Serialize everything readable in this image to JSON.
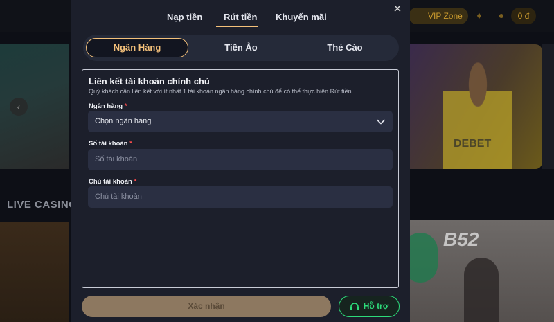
{
  "background": {
    "vip_label": "VIP Zone",
    "balance": "0 đ",
    "section_title": "LIVE CASINO",
    "hero_text": "DEBET",
    "card_text": "B52"
  },
  "modal": {
    "tabs": [
      {
        "label": "Nạp tiền",
        "active": false
      },
      {
        "label": "Rút tiền",
        "active": true
      },
      {
        "label": "Khuyến mãi",
        "active": false
      }
    ],
    "close_icon": "close-icon",
    "subtabs": [
      {
        "label": "Ngân Hàng",
        "active": true
      },
      {
        "label": "Tiền Ảo",
        "active": false
      },
      {
        "label": "Thẻ Cào",
        "active": false
      }
    ],
    "form": {
      "title": "Liên kết tài khoản chính chủ",
      "description": "Quý khách cần liên kết với ít nhất 1 tài khoản ngân hàng chính chủ để có thể thực hiện Rút tiền.",
      "bank": {
        "label": "Ngân hàng",
        "value": "Chọn ngân hàng"
      },
      "account_number": {
        "label": "Số tài khoản",
        "placeholder": "Số tài khoản"
      },
      "account_holder": {
        "label": "Chủ tài khoản",
        "placeholder": "Chủ tài khoản"
      },
      "required_mark": "*"
    },
    "confirm_label": "Xác nhận",
    "support_label": "Hỗ trợ",
    "colors": {
      "accent": "#f3c07a",
      "support_green": "#2ddc7a",
      "required_red": "#ff4d4d",
      "modal_bg": "#1c1f2b"
    }
  }
}
